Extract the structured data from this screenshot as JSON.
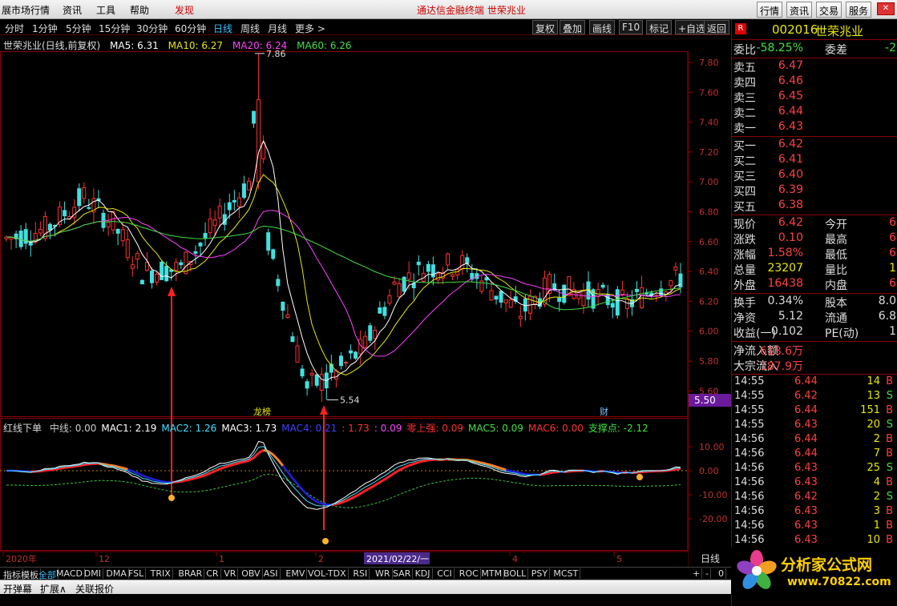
{
  "menubar": {
    "items": [
      "展市场行情",
      "资讯",
      "工具",
      "帮助"
    ],
    "highlight": "发现",
    "title": "通达信金融终端   世荣兆业",
    "right_buttons": [
      "行情",
      "资讯",
      "交易",
      "服务"
    ],
    "win_buttons": [
      "_",
      "□",
      "✕"
    ]
  },
  "periodbar": {
    "periods": [
      "分时",
      "1分钟",
      "5分钟",
      "15分钟",
      "30分钟",
      "60分钟",
      "日线",
      "周线",
      "月线",
      "更多 >"
    ],
    "active": "日线",
    "tools": [
      "复权",
      "叠加",
      "画线",
      "F10",
      "标记",
      "+自选",
      "返回"
    ]
  },
  "main_chart": {
    "title": "世荣兆业(日线,前复权)",
    "ma": [
      {
        "label": "MA5: 6.31",
        "color": "#ffffff"
      },
      {
        "label": "MA10: 6.27",
        "color": "#e8e800"
      },
      {
        "label": "MA20: 6.24",
        "color": "#ff40ff"
      },
      {
        "label": "MA60: 6.26",
        "color": "#40e040"
      }
    ],
    "high_label": "7.86",
    "low_label": "5.54",
    "current_price_tag": "5.50",
    "markers": {
      "dragon": "龙榜",
      "cai": "财"
    },
    "yticks": [
      "7.80",
      "7.60",
      "7.40",
      "7.20",
      "7.00",
      "6.80",
      "6.60",
      "6.40",
      "6.20",
      "6.00",
      "5.80",
      "5.60"
    ]
  },
  "indicator": {
    "name": "红线下单",
    "items": [
      {
        "label": "中线: 0.00",
        "color": "#cccccc"
      },
      {
        "label": "MAC1: 2.19",
        "color": "#ffffff"
      },
      {
        "label": "MAC2: 1.26",
        "color": "#40e0ff"
      },
      {
        "label": "MAC3: 1.73",
        "color": "#ffffff"
      },
      {
        "label": "MAC4: 0.21",
        "color": "#4040ff"
      },
      {
        "label": ": 1.73",
        "color": "#ff3030"
      },
      {
        "label": ": 0.09",
        "color": "#ff40ff"
      },
      {
        "label": "零上强: 0.09",
        "color": "#ff3030"
      },
      {
        "label": "MAC5: 0.09",
        "color": "#40e040"
      },
      {
        "label": "MAC6: 0.00",
        "color": "#ff3030"
      },
      {
        "label": "支撑点: -2.12",
        "color": "#40e040"
      }
    ],
    "yticks": [
      "10.00",
      "0.00",
      "-10.00",
      "-20.00"
    ]
  },
  "xaxis": {
    "labels": [
      "2020年",
      "12",
      "1",
      "2",
      "3",
      "4",
      "5"
    ],
    "cursor_date": "2021/02/22/一",
    "period_tag": "日线"
  },
  "tabs": [
    "指标",
    "模板",
    "全部",
    "MACD",
    "DMI",
    "DMA",
    "FSL",
    "TRIX",
    "BRAR",
    "CR",
    "VR",
    "OBV",
    "ASI",
    "EMV",
    "VOL-TDX",
    "RSI",
    "WR",
    "SAR",
    "KDJ",
    "CCI",
    "ROC",
    "MTM",
    "BOLL",
    "PSY",
    "MCST"
  ],
  "active_tab": "全部",
  "tab_controls": [
    "+",
    "-",
    "0"
  ],
  "bottombar": [
    "开弹幕",
    "扩展∧",
    "关联报价"
  ],
  "rpanel": {
    "code": "002016",
    "name": "世荣兆业",
    "weibi": {
      "label": "委比",
      "value": "-58.25%",
      "label2": "委差",
      "value2": "-2"
    },
    "sells": [
      {
        "label": "卖五",
        "price": "6.47"
      },
      {
        "label": "卖四",
        "price": "6.46"
      },
      {
        "label": "卖三",
        "price": "6.45"
      },
      {
        "label": "卖二",
        "price": "6.44"
      },
      {
        "label": "卖一",
        "price": "6.43"
      }
    ],
    "buys": [
      {
        "label": "买一",
        "price": "6.42"
      },
      {
        "label": "买二",
        "price": "6.41"
      },
      {
        "label": "买三",
        "price": "6.40"
      },
      {
        "label": "买四",
        "price": "6.39"
      },
      {
        "label": "买五",
        "price": "6.38"
      }
    ],
    "stats": [
      {
        "l": "现价",
        "v": "6.42",
        "vc": "#ff4040",
        "l2": "今开",
        "v2": "6"
      },
      {
        "l": "涨跌",
        "v": "0.10",
        "vc": "#ff4040",
        "l2": "最高",
        "v2": "6"
      },
      {
        "l": "涨幅",
        "v": "1.58%",
        "vc": "#ff4040",
        "l2": "最低",
        "v2": "6"
      },
      {
        "l": "总量",
        "v": "23207",
        "vc": "#e8e800",
        "l2": "量比",
        "v2": "1"
      },
      {
        "l": "外盘",
        "v": "16438",
        "vc": "#ff4040",
        "l2": "内盘",
        "v2": "6"
      }
    ],
    "stats2": [
      {
        "l": "换手",
        "v": "0.34%",
        "vc": "#dddddd",
        "l2": "股本",
        "v2": "8.0"
      },
      {
        "l": "净资",
        "v": "5.12",
        "vc": "#dddddd",
        "l2": "流通",
        "v2": "6.8"
      },
      {
        "l": "收益(一)",
        "v": "0.102",
        "vc": "#dddddd",
        "l2": "PE(动)",
        "v2": "1"
      }
    ],
    "flows": [
      {
        "l": "净流入额",
        "v": "618.6万"
      },
      {
        "l": "大宗流入",
        "v": "187.9万"
      }
    ],
    "ticks": [
      {
        "t": "14:55",
        "p": "6.44",
        "q": "14",
        "d": "B"
      },
      {
        "t": "14:55",
        "p": "6.42",
        "q": "13",
        "d": "S"
      },
      {
        "t": "14:55",
        "p": "6.44",
        "q": "151",
        "d": "B"
      },
      {
        "t": "14:55",
        "p": "6.43",
        "q": "20",
        "d": "S"
      },
      {
        "t": "14:56",
        "p": "6.44",
        "q": "2",
        "d": "B"
      },
      {
        "t": "14:56",
        "p": "6.44",
        "q": "7",
        "d": "B"
      },
      {
        "t": "14:56",
        "p": "6.43",
        "q": "25",
        "d": "S"
      },
      {
        "t": "14:56",
        "p": "6.43",
        "q": "4",
        "d": "B"
      },
      {
        "t": "14:56",
        "p": "6.42",
        "q": "2",
        "d": "S"
      },
      {
        "t": "14:56",
        "p": "6.43",
        "q": "3",
        "d": "B"
      },
      {
        "t": "14:56",
        "p": "6.43",
        "q": "1",
        "d": "B"
      },
      {
        "t": "14:56",
        "p": "6.43",
        "q": "10",
        "d": "B"
      }
    ],
    "logo_text": "分析家公式网",
    "logo_url": "www.70822.com"
  }
}
